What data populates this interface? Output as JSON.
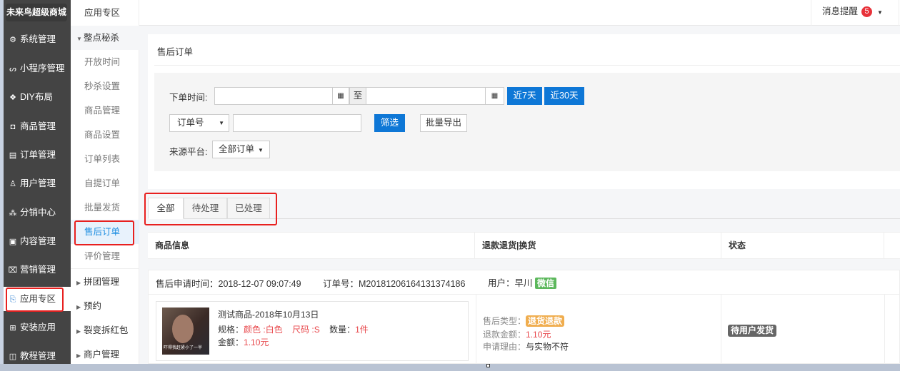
{
  "brand": "未来鸟超级商城",
  "sidebar": {
    "items": [
      {
        "label": "系统管理",
        "icon": "gear-icon",
        "glyph": "⚙"
      },
      {
        "label": "小程序管理",
        "icon": "miniprogram-icon",
        "glyph": "ᔕ"
      },
      {
        "label": "DIY布局",
        "icon": "diy-icon",
        "glyph": "❖"
      },
      {
        "label": "商品管理",
        "icon": "bag-icon",
        "glyph": "◘"
      },
      {
        "label": "订单管理",
        "icon": "order-icon",
        "glyph": "▤"
      },
      {
        "label": "用户管理",
        "icon": "user-icon",
        "glyph": "♙"
      },
      {
        "label": "分销中心",
        "icon": "distribution-icon",
        "glyph": "⁂"
      },
      {
        "label": "内容管理",
        "icon": "content-icon",
        "glyph": "▣"
      },
      {
        "label": "营销管理",
        "icon": "ticket-icon",
        "glyph": "⌧"
      },
      {
        "label": "应用专区",
        "icon": "app-icon",
        "glyph": "⎘",
        "active": true
      },
      {
        "label": "安装应用",
        "icon": "grid-icon",
        "glyph": "⊞"
      },
      {
        "label": "教程管理",
        "icon": "book-icon",
        "glyph": "◫"
      }
    ]
  },
  "subnav": {
    "header": "应用专区",
    "group": "整点秘杀",
    "items": [
      "开放时间",
      "秒杀设置",
      "商品管理",
      "商品设置",
      "订单列表",
      "自提订单",
      "批量发货",
      "售后订单",
      "评价管理"
    ],
    "active": "售后订单",
    "groups": [
      "拼团管理",
      "预约",
      "裂变拆红包",
      "商户管理"
    ]
  },
  "topbar": {
    "notify_label": "消息提醒",
    "notify_count": "5"
  },
  "page": {
    "title": "售后订单"
  },
  "filter": {
    "order_time_label": "下单时间:",
    "to_label": "至",
    "start_date": "",
    "end_date": "",
    "last7": "近7天",
    "last30": "近30天",
    "search_field": "订单号",
    "keyword": "",
    "search_btn": "筛选",
    "export_btn": "批量导出",
    "source_label": "来源平台:",
    "source_value": "全部订单"
  },
  "tabs": [
    "全部",
    "待处理",
    "已处理"
  ],
  "table": {
    "headers": [
      "商品信息",
      "退款退货|换货",
      "状态"
    ]
  },
  "order": {
    "apply_time": "售后申请时间：2018-12-07 09:07:49",
    "order_no": "订单号：M20181206164131374186",
    "user": "用户：早川",
    "platform": "微信",
    "product_name": "测试商品-2018年10月13日",
    "thumb_caption": "吓得我赶紧小了一半",
    "spec_label": "规格：",
    "color": "颜色 :白色",
    "size": "尺码 :S",
    "qty_label": "数量：",
    "qty": "1件",
    "amount_label": "金额：",
    "amount": "1.10元",
    "type_label": "售后类型：",
    "type": "退货退款",
    "refund_label": "退款金额：",
    "refund": "1.10元",
    "reason_label": "申请理由：",
    "reason": "与实物不符",
    "status": "待用户发货"
  },
  "colors": {
    "primary": "#0e77d6",
    "sidebar": "#444444",
    "highlight": "#e8201f"
  }
}
